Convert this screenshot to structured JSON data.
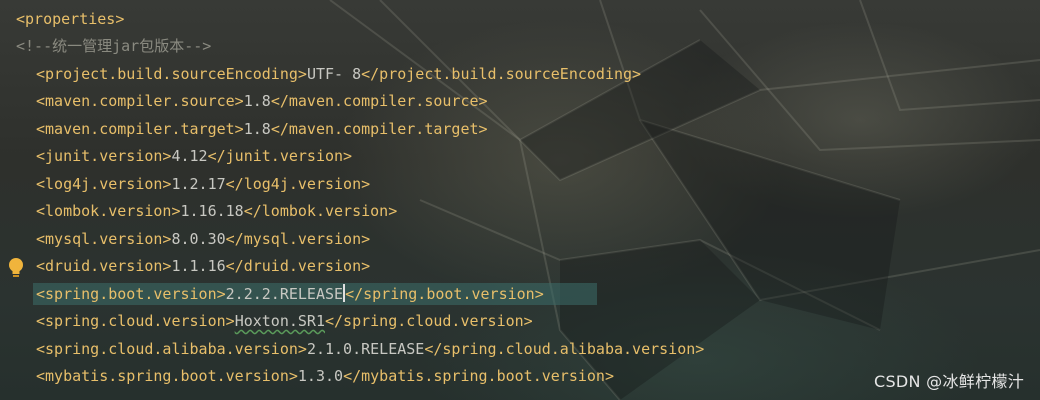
{
  "editor": {
    "properties_open": "<properties>",
    "comment": "<!--统一管理jar包版本-->",
    "lines": [
      {
        "open": "<project.build.sourceEncoding>",
        "value": "UTF- 8",
        "close": "</project.build.sourceEncoding>"
      },
      {
        "open": "<maven.compiler.source>",
        "value": "1.8",
        "close": "</maven.compiler.source>"
      },
      {
        "open": "<maven.compiler.target>",
        "value": "1.8",
        "close": "</maven.compiler.target>"
      },
      {
        "open": "<junit.version>",
        "value": "4.12",
        "close": "</junit.version>"
      },
      {
        "open": "<log4j.version>",
        "value": "1.2.17",
        "close": "</log4j.version>"
      },
      {
        "open": "<lombok.version>",
        "value": "1.16.18",
        "close": "</lombok.version>"
      },
      {
        "open": "<mysql.version>",
        "value": "8.0.30",
        "close": "</mysql.version>"
      },
      {
        "open": "<druid.version>",
        "value": "1.1.16",
        "close": "</druid.version>"
      },
      {
        "open": "<spring.boot.version>",
        "value": "2.2.2.RELEASE",
        "close": "</spring.boot.version>"
      },
      {
        "open": "<spring.cloud.version>",
        "value": "Hoxton.SR1",
        "close": "</spring.cloud.version>"
      },
      {
        "open": "<spring.cloud.alibaba.version>",
        "value": "2.1.0.RELEASE",
        "close": "</spring.cloud.alibaba.version>"
      },
      {
        "open": "<mybatis.spring.boot.version>",
        "value": "1.3.0",
        "close": "</mybatis.spring.boot.version>"
      }
    ]
  },
  "gutter": {
    "icon": "lightbulb-icon"
  },
  "watermark": "CSDN @冰鲜柠檬汁",
  "colors": {
    "tag": "#e8bf6a",
    "value": "#c8c8c2",
    "comment": "#8a8a80",
    "current_line": "#3c6e69"
  }
}
